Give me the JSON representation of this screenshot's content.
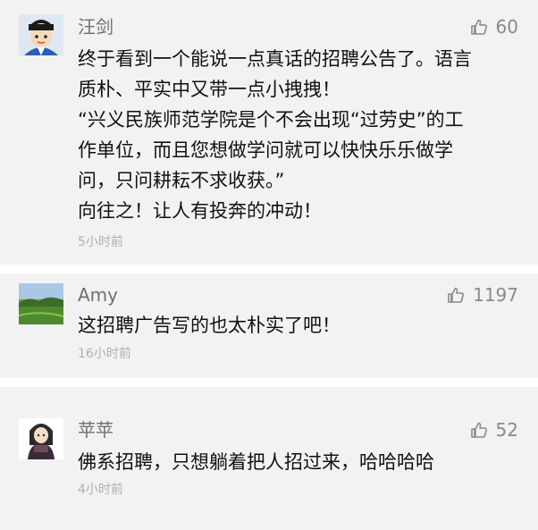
{
  "comments": [
    {
      "author": "汪剑",
      "likes": "60",
      "lines": [
        "终于看到一个能说一点真话的招聘公告了。语言",
        "质朴、平实中又带一点小拽拽！",
        "“兴义民族师范学院是个不会出现“过劳史”的工",
        "作单位，而且您想做学问就可以快快乐乐做学",
        "问，只问耕耘不求收获。”",
        "向往之！让人有投奔的冲动！"
      ],
      "time": "5小时前",
      "avatar": "cartoon-official-avatar"
    },
    {
      "author": "Amy",
      "likes": "1197",
      "lines": [
        "这招聘广告写的也太朴实了吧！"
      ],
      "time": "16小时前",
      "avatar": "landscape-photo-avatar"
    },
    {
      "author": "苹苹",
      "likes": "52",
      "lines": [
        "佛系招聘，只想躺着把人招过来，哈哈哈哈"
      ],
      "time": "4小时前",
      "avatar": "girl-illustration-avatar"
    }
  ],
  "icons": {
    "like": "thumbs-up-icon"
  },
  "colors": {
    "card_bg": "#f2f2f2",
    "name": "#6f6f6f",
    "meta": "#8a8a8a",
    "time": "#b0b0b0",
    "text": "#111111"
  }
}
